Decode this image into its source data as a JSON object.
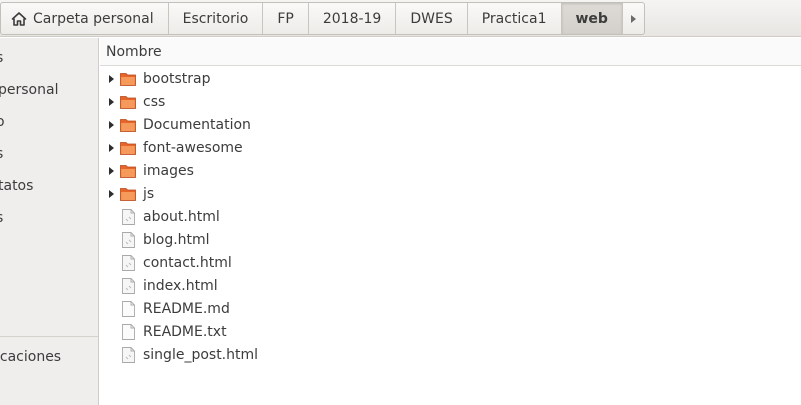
{
  "pathbar": {
    "crumbs": [
      "Carpeta personal",
      "Escritorio",
      "FP",
      "2018-19",
      "DWES",
      "Practica1",
      "web"
    ],
    "active_index": 6,
    "overflow_icon": "triangle-right-icon"
  },
  "sidebar": {
    "items": [
      "s",
      "personal",
      "o",
      "s",
      "tatos",
      "s",
      "icaciones"
    ]
  },
  "columns": {
    "name": "Nombre"
  },
  "files": [
    {
      "name": "bootstrap",
      "type": "folder"
    },
    {
      "name": "css",
      "type": "folder"
    },
    {
      "name": "Documentation",
      "type": "folder"
    },
    {
      "name": "font-awesome",
      "type": "folder"
    },
    {
      "name": "images",
      "type": "folder"
    },
    {
      "name": "js",
      "type": "folder"
    },
    {
      "name": "about.html",
      "type": "html"
    },
    {
      "name": "blog.html",
      "type": "html"
    },
    {
      "name": "contact.html",
      "type": "html"
    },
    {
      "name": "index.html",
      "type": "html"
    },
    {
      "name": "README.md",
      "type": "text"
    },
    {
      "name": "README.txt",
      "type": "text"
    },
    {
      "name": "single_post.html",
      "type": "html"
    }
  ],
  "colors": {
    "folder": "#e8652a",
    "folder_light": "#f59a5a"
  }
}
